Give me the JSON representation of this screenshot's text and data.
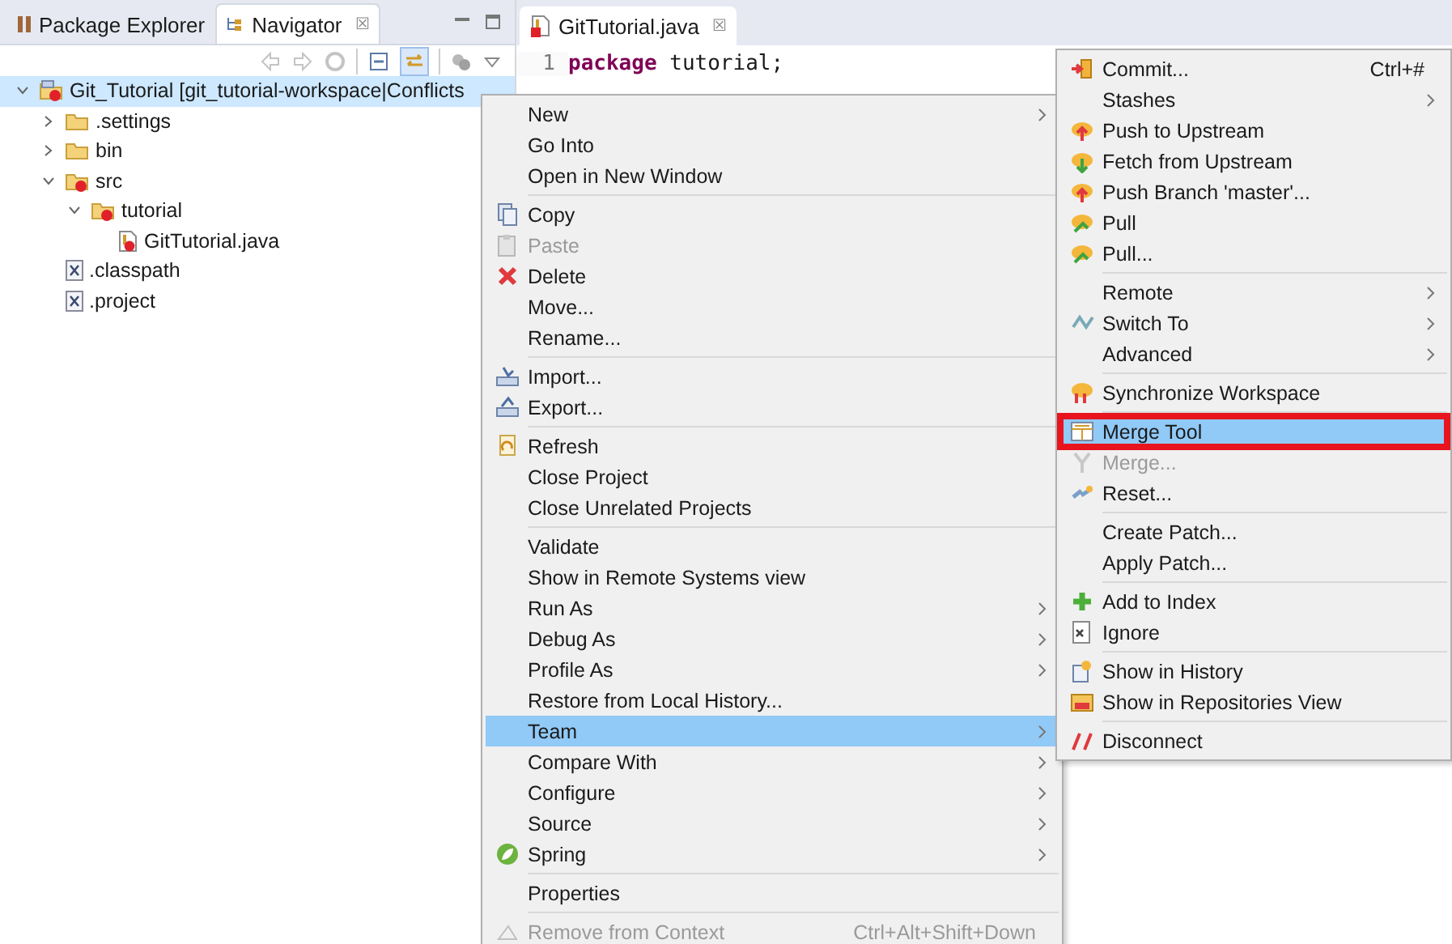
{
  "navigator_panel": {
    "tabs": [
      {
        "label": "Package Explorer",
        "selected": false
      },
      {
        "label": "Navigator",
        "selected": true,
        "close": "☒"
      }
    ],
    "tree": [
      {
        "label": "Git_Tutorial [git_tutorial-workspace|Conflicts",
        "kind": "project",
        "conflict": true,
        "expanded": true,
        "selected": true,
        "children": [
          {
            "label": ".settings",
            "kind": "folder",
            "conflict": false,
            "expanded": false,
            "selected": false
          },
          {
            "label": "bin",
            "kind": "folder",
            "conflict": false,
            "expanded": false,
            "selected": false
          },
          {
            "label": "src",
            "kind": "folder",
            "conflict": true,
            "expanded": true,
            "selected": false,
            "children": [
              {
                "label": "tutorial",
                "kind": "folder",
                "conflict": true,
                "expanded": true,
                "selected": false,
                "children": [
                  {
                    "label": "GitTutorial.java",
                    "kind": "java",
                    "conflict": true,
                    "selected": false
                  }
                ]
              }
            ]
          },
          {
            "label": ".classpath",
            "kind": "xml",
            "conflict": false,
            "selected": false
          },
          {
            "label": ".project",
            "kind": "xml",
            "conflict": false,
            "selected": false
          }
        ]
      }
    ]
  },
  "editor": {
    "tab": {
      "label": "GitTutorial.java",
      "close": "☒"
    },
    "lines": [
      {
        "number": "1",
        "keyword": "package",
        "text": " tutorial;"
      }
    ]
  },
  "context_menu": {
    "groups": [
      [
        {
          "label": "New",
          "submenu": true,
          "disabled": false,
          "selected": false
        },
        {
          "label": "Go Into",
          "submenu": false,
          "disabled": false,
          "selected": false
        },
        {
          "label": "Open in New Window",
          "submenu": false,
          "disabled": false,
          "selected": false
        }
      ],
      [
        {
          "label": "Copy",
          "submenu": false,
          "disabled": false,
          "selected": false
        },
        {
          "label": "Paste",
          "submenu": false,
          "disabled": true,
          "selected": false
        },
        {
          "label": "Delete",
          "submenu": false,
          "disabled": false,
          "selected": false
        },
        {
          "label": "Move...",
          "submenu": false,
          "disabled": false,
          "selected": false
        },
        {
          "label": "Rename...",
          "submenu": false,
          "disabled": false,
          "selected": false
        }
      ],
      [
        {
          "label": "Import...",
          "submenu": false,
          "disabled": false,
          "selected": false
        },
        {
          "label": "Export...",
          "submenu": false,
          "disabled": false,
          "selected": false
        }
      ],
      [
        {
          "label": "Refresh",
          "submenu": false,
          "disabled": false,
          "selected": false
        },
        {
          "label": "Close Project",
          "submenu": false,
          "disabled": false,
          "selected": false
        },
        {
          "label": "Close Unrelated Projects",
          "submenu": false,
          "disabled": false,
          "selected": false
        }
      ],
      [
        {
          "label": "Validate",
          "submenu": false,
          "disabled": false,
          "selected": false
        },
        {
          "label": "Show in Remote Systems view",
          "submenu": false,
          "disabled": false,
          "selected": false
        },
        {
          "label": "Run As",
          "submenu": true,
          "disabled": false,
          "selected": false
        },
        {
          "label": "Debug As",
          "submenu": true,
          "disabled": false,
          "selected": false
        },
        {
          "label": "Profile As",
          "submenu": true,
          "disabled": false,
          "selected": false
        },
        {
          "label": "Restore from Local History...",
          "submenu": false,
          "disabled": false,
          "selected": false
        },
        {
          "label": "Team",
          "submenu": true,
          "disabled": false,
          "selected": true
        },
        {
          "label": "Compare With",
          "submenu": true,
          "disabled": false,
          "selected": false
        },
        {
          "label": "Configure",
          "submenu": true,
          "disabled": false,
          "selected": false
        },
        {
          "label": "Source",
          "submenu": true,
          "disabled": false,
          "selected": false
        },
        {
          "label": "Spring",
          "submenu": true,
          "disabled": false,
          "selected": false
        }
      ],
      [
        {
          "label": "Properties",
          "submenu": false,
          "disabled": false,
          "selected": false
        }
      ],
      [
        {
          "label": "Remove from Context",
          "submenu": false,
          "disabled": true,
          "selected": false,
          "shortcut": "Ctrl+Alt+Shift+Down"
        }
      ]
    ]
  },
  "team_submenu": {
    "groups": [
      [
        {
          "label": "Commit...",
          "submenu": false,
          "disabled": false,
          "selected": false,
          "shortcut": "Ctrl+#"
        },
        {
          "label": "Stashes",
          "submenu": true,
          "disabled": false,
          "selected": false
        },
        {
          "label": "Push to Upstream",
          "submenu": false,
          "disabled": false,
          "selected": false
        },
        {
          "label": "Fetch from Upstream",
          "submenu": false,
          "disabled": false,
          "selected": false
        },
        {
          "label": "Push Branch 'master'...",
          "submenu": false,
          "disabled": false,
          "selected": false
        },
        {
          "label": "Pull",
          "submenu": false,
          "disabled": false,
          "selected": false
        },
        {
          "label": "Pull...",
          "submenu": false,
          "disabled": false,
          "selected": false
        }
      ],
      [
        {
          "label": "Remote",
          "submenu": true,
          "disabled": false,
          "selected": false
        },
        {
          "label": "Switch To",
          "submenu": true,
          "disabled": false,
          "selected": false
        },
        {
          "label": "Advanced",
          "submenu": true,
          "disabled": false,
          "selected": false
        }
      ],
      [
        {
          "label": "Synchronize Workspace",
          "submenu": false,
          "disabled": false,
          "selected": false
        }
      ],
      [
        {
          "label": "Merge Tool",
          "submenu": false,
          "disabled": false,
          "selected": true,
          "outlined": true
        },
        {
          "label": "Merge...",
          "submenu": false,
          "disabled": true,
          "selected": false
        },
        {
          "label": "Reset...",
          "submenu": false,
          "disabled": false,
          "selected": false
        }
      ],
      [
        {
          "label": "Create Patch...",
          "submenu": false,
          "disabled": false,
          "selected": false
        },
        {
          "label": "Apply Patch...",
          "submenu": false,
          "disabled": false,
          "selected": false
        }
      ],
      [
        {
          "label": "Add to Index",
          "submenu": false,
          "disabled": false,
          "selected": false
        },
        {
          "label": "Ignore",
          "submenu": false,
          "disabled": false,
          "selected": false
        }
      ],
      [
        {
          "label": "Show in History",
          "submenu": false,
          "disabled": false,
          "selected": false
        },
        {
          "label": "Show in Repositories View",
          "submenu": false,
          "disabled": false,
          "selected": false
        }
      ],
      [
        {
          "label": "Disconnect",
          "submenu": false,
          "disabled": false,
          "selected": false
        }
      ]
    ]
  }
}
